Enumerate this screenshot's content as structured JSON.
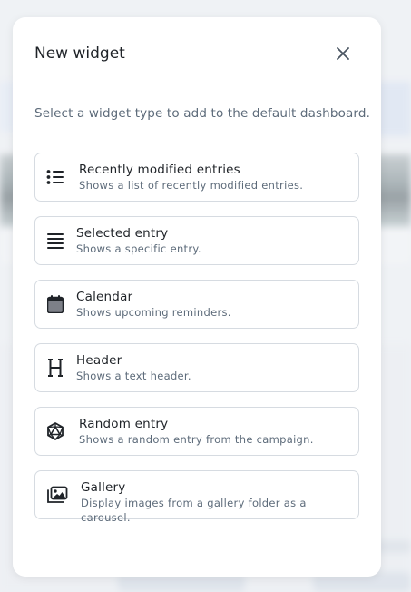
{
  "dialog": {
    "title": "New widget",
    "close_icon": "close-icon",
    "subtitle": "Select a widget type to add to the default dashboard."
  },
  "widgets": [
    {
      "label": "Recently modified entries",
      "description": "Shows a list of recently modified entries.",
      "icon": "list-icon"
    },
    {
      "label": "Selected entry",
      "description": "Shows a specific entry.",
      "icon": "lines-icon"
    },
    {
      "label": "Calendar",
      "description": "Shows upcoming reminders.",
      "icon": "calendar-icon"
    },
    {
      "label": "Header",
      "description": "Shows a text header.",
      "icon": "heading-icon"
    },
    {
      "label": "Random entry",
      "description": "Shows a random entry from the campaign.",
      "icon": "dice-icon"
    },
    {
      "label": "Gallery",
      "description": "Display images from a gallery folder as a carousel.",
      "icon": "images-icon"
    }
  ]
}
